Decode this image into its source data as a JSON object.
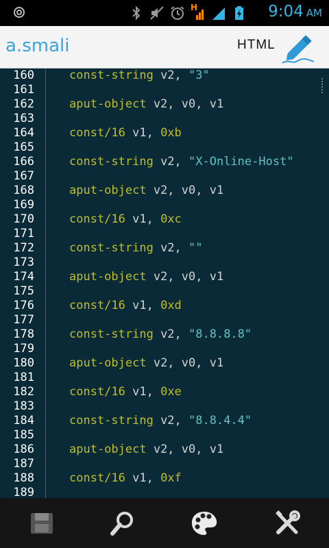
{
  "status_bar": {
    "time": "9:04",
    "ampm": "AM",
    "network_letter": "H",
    "icons": [
      "settings-icon",
      "bluetooth-icon",
      "mute-icon",
      "alarm-icon",
      "signal-h-icon",
      "signal-icon",
      "battery-charging-icon"
    ]
  },
  "title_bar": {
    "file_name": "a.smali",
    "mode_label": "HTML"
  },
  "editor": {
    "colors": {
      "background": "#0b2a38",
      "keyword": "#bfbf2a",
      "register": "#d4d4d4",
      "string": "#5fc3c3",
      "line_number": "#ffffff"
    },
    "lines": [
      {
        "num": "160",
        "kw": "const-string",
        "regs": " v2, ",
        "str": "\"3\""
      },
      {
        "num": "161",
        "kw": "",
        "regs": "",
        "str": ""
      },
      {
        "num": "162",
        "kw": "aput-object",
        "regs": " v2, v0, v1",
        "str": ""
      },
      {
        "num": "163",
        "kw": "",
        "regs": "",
        "str": ""
      },
      {
        "num": "164",
        "kw": "const/16",
        "regs": " v1, ",
        "str": "0xb"
      },
      {
        "num": "165",
        "kw": "",
        "regs": "",
        "str": ""
      },
      {
        "num": "166",
        "kw": "const-string",
        "regs": " v2, ",
        "str": "\"X-Online-Host\""
      },
      {
        "num": "167",
        "kw": "",
        "regs": "",
        "str": ""
      },
      {
        "num": "168",
        "kw": "aput-object",
        "regs": " v2, v0, v1",
        "str": ""
      },
      {
        "num": "169",
        "kw": "",
        "regs": "",
        "str": ""
      },
      {
        "num": "170",
        "kw": "const/16",
        "regs": " v1, ",
        "str": "0xc"
      },
      {
        "num": "171",
        "kw": "",
        "regs": "",
        "str": ""
      },
      {
        "num": "172",
        "kw": "const-string",
        "regs": " v2, ",
        "str": "\"\""
      },
      {
        "num": "173",
        "kw": "",
        "regs": "",
        "str": ""
      },
      {
        "num": "174",
        "kw": "aput-object",
        "regs": " v2, v0, v1",
        "str": ""
      },
      {
        "num": "175",
        "kw": "",
        "regs": "",
        "str": ""
      },
      {
        "num": "176",
        "kw": "const/16",
        "regs": " v1, ",
        "str": "0xd"
      },
      {
        "num": "177",
        "kw": "",
        "regs": "",
        "str": ""
      },
      {
        "num": "178",
        "kw": "const-string",
        "regs": " v2, ",
        "str": "\"8.8.8.8\""
      },
      {
        "num": "179",
        "kw": "",
        "regs": "",
        "str": ""
      },
      {
        "num": "180",
        "kw": "aput-object",
        "regs": " v2, v0, v1",
        "str": ""
      },
      {
        "num": "181",
        "kw": "",
        "regs": "",
        "str": ""
      },
      {
        "num": "182",
        "kw": "const/16",
        "regs": " v1, ",
        "str": "0xe"
      },
      {
        "num": "183",
        "kw": "",
        "regs": "",
        "str": ""
      },
      {
        "num": "184",
        "kw": "const-string",
        "regs": " v2, ",
        "str": "\"8.8.4.4\""
      },
      {
        "num": "185",
        "kw": "",
        "regs": "",
        "str": ""
      },
      {
        "num": "186",
        "kw": "aput-object",
        "regs": " v2, v0, v1",
        "str": ""
      },
      {
        "num": "187",
        "kw": "",
        "regs": "",
        "str": ""
      },
      {
        "num": "188",
        "kw": "const/16",
        "regs": " v1, ",
        "str": "0xf"
      },
      {
        "num": "189",
        "kw": "",
        "regs": "",
        "str": ""
      }
    ]
  },
  "bottom_bar": {
    "buttons": [
      "save-icon",
      "search-icon",
      "palette-icon",
      "tools-icon"
    ]
  }
}
